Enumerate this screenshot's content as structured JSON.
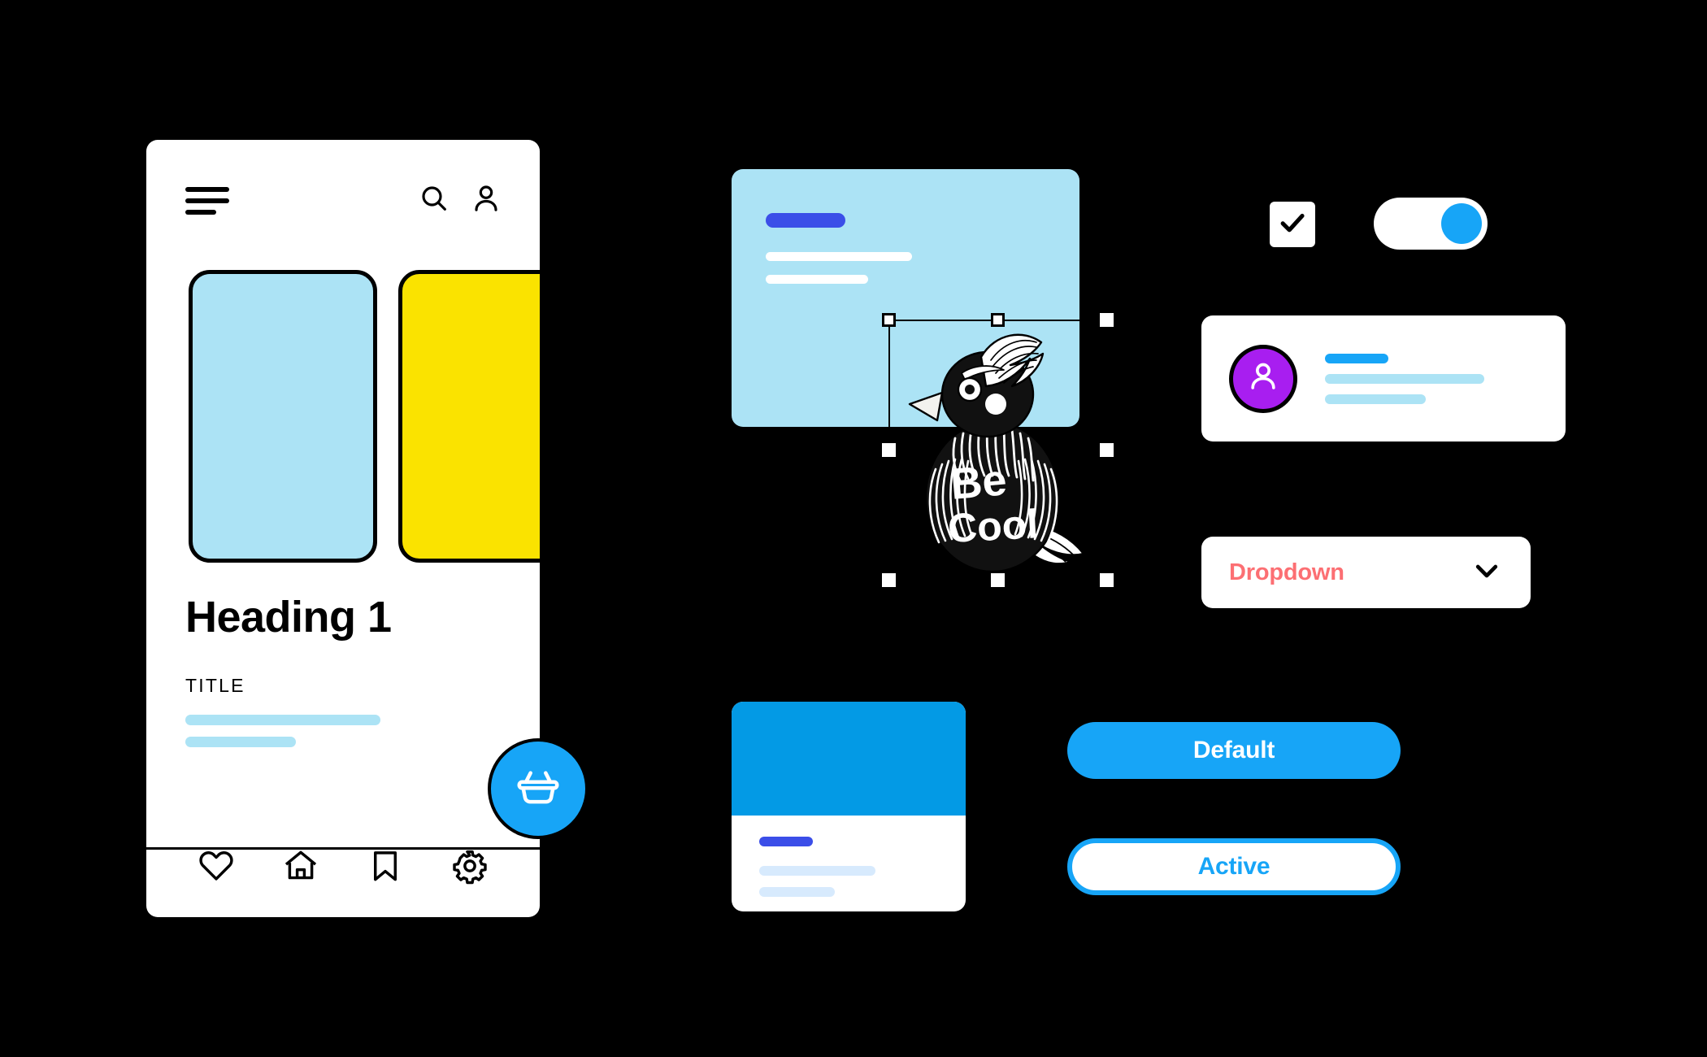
{
  "phone": {
    "menu_icon": "hamburger-menu-icon",
    "search_icon": "search-icon",
    "account_icon": "user-account-icon",
    "card_blue_color": "#ace3f5",
    "card_yellow_color": "#fae300",
    "heading": "Heading 1",
    "title_label": "TITLE",
    "nav_items": [
      {
        "icon": "heart-icon",
        "label": "Favorites"
      },
      {
        "icon": "home-icon",
        "label": "Home"
      },
      {
        "icon": "bookmark-icon",
        "label": "Saved"
      },
      {
        "icon": "gear-icon",
        "label": "Settings"
      }
    ],
    "fab": {
      "icon": "shopping-basket-icon",
      "color": "#17a5f7"
    }
  },
  "hero_card": {
    "background": "#ace3f5",
    "pill_color": "#3b4ee8"
  },
  "bird": {
    "lettering_line1": "Be",
    "lettering_line2": "Cool",
    "handle_count": 8
  },
  "controls": {
    "checkbox": {
      "checked": true,
      "icon": "checkmark-icon"
    },
    "toggle": {
      "state": "on",
      "knob_color": "#17a5f7"
    }
  },
  "profile_card": {
    "avatar_icon": "user-avatar-icon",
    "avatar_color": "#a81ef0",
    "title_bar_color": "#17a5f7"
  },
  "dropdown": {
    "label": "Dropdown",
    "label_color": "#fc6f73",
    "chevron_icon": "chevron-down-icon"
  },
  "media_card": {
    "image_color": "#039ae5",
    "pill_color": "#3b4ee8"
  },
  "buttons": {
    "default": {
      "label": "Default",
      "background": "#17a5f7",
      "text_color": "#ffffff"
    },
    "active": {
      "label": "Active",
      "background": "#ffffff",
      "text_color": "#17a5f7",
      "border_color": "#17a5f7"
    }
  }
}
